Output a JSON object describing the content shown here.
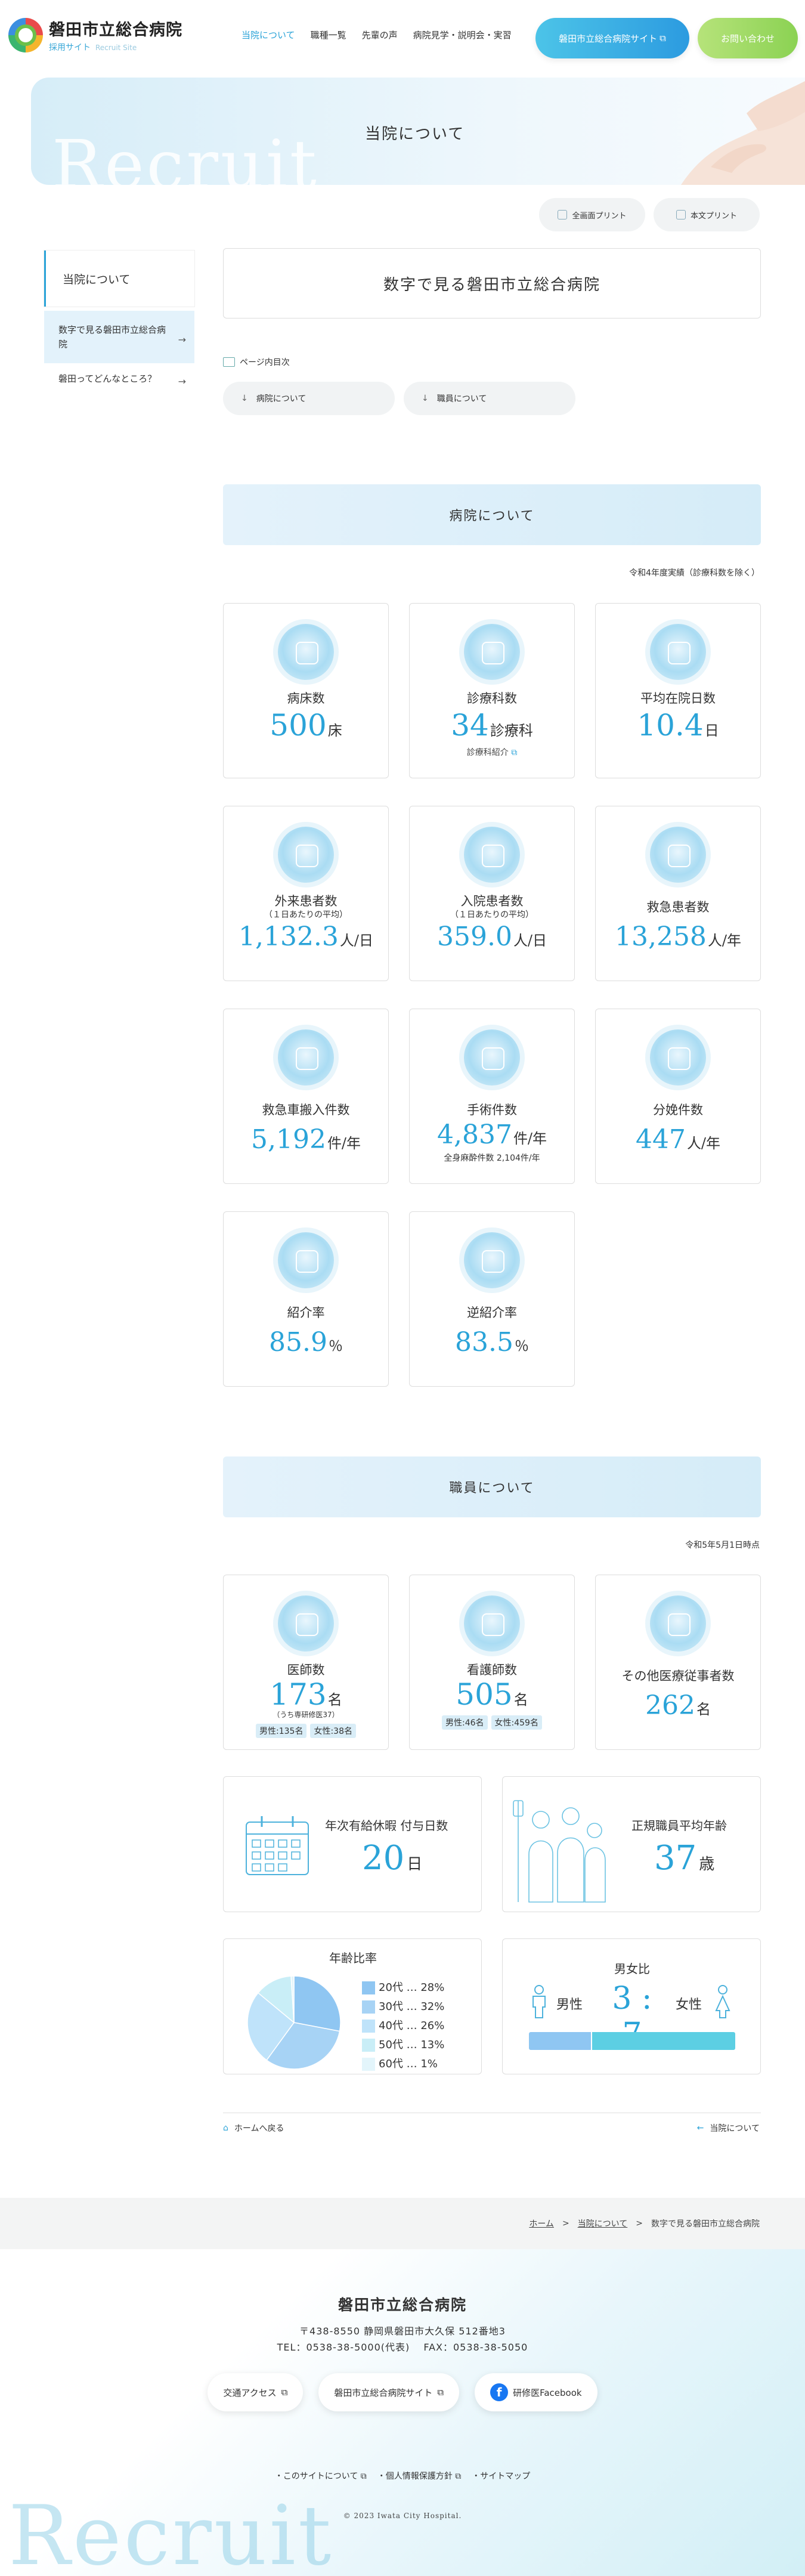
{
  "header": {
    "logo_title": "磐田市立総合病院",
    "logo_sub": "採用サイト",
    "logo_sub_en": "Recruit Site",
    "nav": [
      "当院について",
      "職種一覧",
      "先輩の声",
      "病院見学・説明会・実習"
    ],
    "site_button": "磐田市立総合病院サイト",
    "contact_button": "お問い合わせ"
  },
  "hero": {
    "title": "当院について",
    "bg_text": "Recruit"
  },
  "print": {
    "all": "全画面プリント",
    "body": "本文プリント"
  },
  "sidebar": {
    "head": "当院について",
    "items": [
      {
        "label": "数字で見る磐田市立総合病院"
      },
      {
        "label": "磐田ってどんなところ？"
      }
    ]
  },
  "page_title": "数字で見る磐田市立総合病院",
  "toc": {
    "label": "ページ内目次",
    "items": [
      "病院について",
      "職員について"
    ]
  },
  "hospital": {
    "heading": "病院について",
    "note": "令和4年度実績（診療科数を除く）",
    "cards": [
      {
        "label": "病床数",
        "value": "500",
        "unit": "床"
      },
      {
        "label": "診療科数",
        "value": "34",
        "unit": "診療科",
        "link": "診療科紹介"
      },
      {
        "label": "平均在院日数",
        "value": "10.4",
        "unit": "日"
      },
      {
        "label": "外来患者数",
        "small": "（１日あたりの平均）",
        "value": "1,132.3",
        "unit": "人/日"
      },
      {
        "label": "入院患者数",
        "small": "（１日あたりの平均）",
        "value": "359.0",
        "unit": "人/日"
      },
      {
        "label": "救急患者数",
        "value": "13,258",
        "unit": "人/年"
      },
      {
        "label": "救急車搬入件数",
        "value": "5,192",
        "unit": "件/年"
      },
      {
        "label": "手術件数",
        "value": "4,837",
        "unit": "件/年",
        "sub": "全身麻酔件数 2,104件/年"
      },
      {
        "label": "分娩件数",
        "value": "447",
        "unit": "人/年"
      },
      {
        "label": "紹介率",
        "value": "85.9",
        "unit": "％"
      },
      {
        "label": "逆紹介率",
        "value": "83.5",
        "unit": "％"
      }
    ]
  },
  "staff": {
    "heading": "職員について",
    "note": "令和5年5月1日時点",
    "cards": [
      {
        "label": "医師数",
        "value": "173",
        "unit": "名",
        "small": "（うち専研修医37）",
        "male": "男性:135名",
        "female": "女性:38名"
      },
      {
        "label": "看護師数",
        "value": "505",
        "unit": "名",
        "male": "男性:46名",
        "female": "女性:459名"
      },
      {
        "label": "その他医療従事者数",
        "value": "262",
        "unit": "名"
      }
    ],
    "leave": {
      "label": "年次有給休暇 付与日数",
      "value": "20",
      "unit": "日"
    },
    "age": {
      "label": "正規職員平均年齢",
      "value": "37",
      "unit": "歳"
    },
    "age_ratio": {
      "title": "年齢比率"
    },
    "gender": {
      "title": "男女比",
      "male_label": "男性",
      "female_label": "女性",
      "ratio": "3 : 7"
    }
  },
  "chart_data": {
    "type": "pie",
    "title": "年齢比率",
    "categories": [
      "20代",
      "30代",
      "40代",
      "50代",
      "60代"
    ],
    "values": [
      28,
      32,
      26,
      13,
      1
    ],
    "legend": [
      "20代 … 28%",
      "30代 … 32%",
      "40代 … 26%",
      "50代 … 13%",
      "60代 …  1%"
    ],
    "colors": [
      "#8fc6f2",
      "#a7d3f5",
      "#bfe3fa",
      "#c9eef7",
      "#e3f5fb"
    ]
  },
  "gender_ratio": {
    "male": 0.3,
    "female": 0.7,
    "male_color": "#8fc6f2",
    "female_color": "#5ccfe3"
  },
  "pagenav": {
    "home": "ホームへ戻る",
    "back": "当院について"
  },
  "breadcrumb": {
    "home": "ホーム",
    "parent": "当院について",
    "current": "数字で見る磐田市立総合病院"
  },
  "footer": {
    "name": "磐田市立総合病院",
    "address": "〒438-8550 静岡県磐田市大久保 512番地3",
    "tel": "TEL：0538-38-5000(代表)　 FAX：0538-38-5050",
    "buttons": [
      "交通アクセス",
      "磐田市立総合病院サイト",
      "研修医Facebook"
    ],
    "links": [
      "このサイトについて",
      "個人情報保護方針",
      "サイトマップ"
    ],
    "copyright": "© 2023 Iwata City Hospital.",
    "bg_text": "Recruit"
  }
}
